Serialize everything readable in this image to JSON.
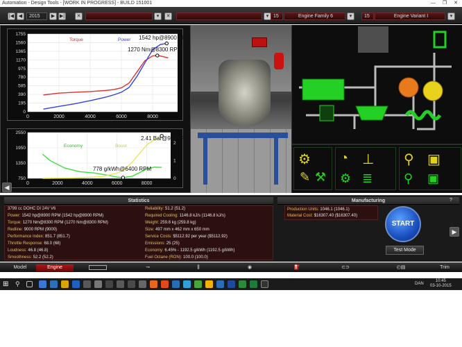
{
  "window": {
    "title": "Automation - Design Tools - [WORK IN PROGRESS] - BUILD 151001",
    "controls": [
      "—",
      "❐",
      "✕"
    ]
  },
  "topbar": {
    "year": "2015",
    "family_prefix": "15",
    "family_name": "Engine Family 6",
    "variant_prefix": "15",
    "variant_name": "Engine Variant I"
  },
  "power_chart": {
    "legend_torque": "Torque",
    "legend_power": "Power",
    "peak_power": "1542 hp@8900 RPM",
    "peak_torque": "1270 Nm@8300 RPM"
  },
  "econ_chart": {
    "legend_economy": "Economy",
    "legend_boost": "Boost",
    "peak_boost": "2.41 Bar@9000 RPM",
    "best_economy": "778 g/kWh@6400 RPM"
  },
  "chart_data": [
    {
      "type": "line",
      "xlim": [
        0,
        9600
      ],
      "ylim": [
        0,
        1755
      ],
      "yticks": [
        "1755",
        "1560",
        "1365",
        "1170",
        "975",
        "780",
        "585",
        "390",
        "195",
        "0"
      ],
      "xticks": [
        "0",
        "2000",
        "4000",
        "6000",
        "8000"
      ],
      "series": [
        {
          "name": "Torque",
          "color": "#e03030",
          "x": [
            1000,
            2000,
            3000,
            4000,
            5000,
            5500,
            6000,
            6500,
            7000,
            7500,
            8000,
            8300,
            8600,
            9000
          ],
          "y": [
            380,
            420,
            440,
            455,
            480,
            500,
            540,
            650,
            900,
            1150,
            1260,
            1270,
            1250,
            1215
          ]
        },
        {
          "name": "Power",
          "color": "#3340e0",
          "x": [
            1000,
            2000,
            3000,
            4000,
            5000,
            5500,
            6000,
            6500,
            7000,
            7500,
            8000,
            8500,
            8900,
            9000
          ],
          "y": [
            60,
            120,
            180,
            250,
            330,
            380,
            440,
            550,
            800,
            1100,
            1400,
            1520,
            1542,
            1535
          ]
        }
      ]
    },
    {
      "type": "line",
      "xlim": [
        0,
        9600
      ],
      "ylim": [
        750,
        2550
      ],
      "yticks": [
        "2550",
        "1950",
        "1350",
        "750"
      ],
      "y2ticks": [
        "2",
        "1",
        "0"
      ],
      "xticks": [
        "0",
        "2000",
        "4000",
        "6000",
        "8000"
      ],
      "series": [
        {
          "name": "Economy",
          "color": "#3ce03c",
          "x": [
            1000,
            1500,
            2500,
            3500,
            4500,
            5500,
            6000,
            6400,
            7000,
            7500,
            8000,
            8500,
            9000
          ],
          "y": [
            1700,
            1450,
            1150,
            1010,
            960,
            860,
            800,
            778,
            830,
            970,
            1120,
            1190,
            1180
          ]
        },
        {
          "name": "Boost",
          "color": "#e8e85a",
          "x": [
            1000,
            3000,
            5000,
            6000,
            6500,
            7000,
            7500,
            8000,
            8500,
            9000
          ],
          "y": [
            0,
            0.02,
            0.1,
            0.3,
            0.5,
            0.9,
            1.4,
            1.9,
            2.2,
            2.41
          ]
        }
      ]
    }
  ],
  "statistics": {
    "header": "Statistics",
    "col1": [
      {
        "k": "",
        "v": "3799 cc DOHC DI 24V V6"
      },
      {
        "k": "Power: ",
        "v": "1542 hp@8900 RPM (1542 hp@8900 RPM)"
      },
      {
        "k": "Torque: ",
        "v": "1270 Nm@8300 RPM (1270 Nm@8300 RPM)"
      },
      {
        "k": "Redline: ",
        "v": "9000 RPM (9000)"
      },
      {
        "k": "Performance Index: ",
        "v": "851.7 (851.7)"
      },
      {
        "k": "Throttle Response: ",
        "v": "68.0 (68)"
      },
      {
        "k": "Loudness: ",
        "v": "46.8 (46.8)"
      },
      {
        "k": "Smoothness: ",
        "v": "52.2 (52.2)"
      }
    ],
    "col2": [
      {
        "k": "Reliability: ",
        "v": "51.2 (51.2)"
      },
      {
        "k": "Required Cooling: ",
        "v": "1146.8 kJ/s (1146.8 kJ/s)"
      },
      {
        "k": "Weight: ",
        "v": "259.8 kg (259.8 kg)"
      },
      {
        "k": "Size: ",
        "v": "497 mm x 462 mm x 650 mm"
      },
      {
        "k": "Service Costs: ",
        "v": "$5112.92 per year ($5112.92)"
      },
      {
        "k": "Emissions: ",
        "v": "25 (25)"
      },
      {
        "k": "Economy: ",
        "v": "6.45% - 1192.5 g/kWh (1192.5 g/kWh)"
      },
      {
        "k": "Fuel Octane (RON): ",
        "v": "100.0 (100.0)"
      }
    ]
  },
  "manufacturing": {
    "header": "Manufacturing",
    "help": "?",
    "rows": [
      {
        "k": "Production Units: ",
        "v": "1046.1 (1046.1)"
      },
      {
        "k": "Material Cost: ",
        "v": "$16307.40 ($16307.40)"
      }
    ],
    "start": "START",
    "test_mode": "Test Mode"
  },
  "nav": {
    "model": "Model",
    "engine": "Engine",
    "trim": "Trim"
  },
  "taskbar": {
    "lang": "DAN",
    "time": "10:45",
    "date": "03-10-2015"
  },
  "colors": {
    "accent_red": "#b51515",
    "diagram_green": "#2be02b",
    "diagram_orange": "#e87a1e",
    "icon_yellow": "#e0d21a"
  }
}
